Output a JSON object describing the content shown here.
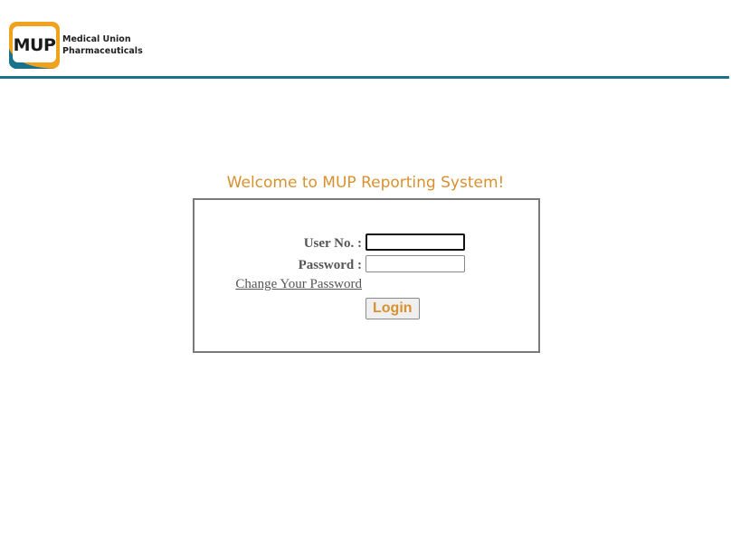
{
  "header": {
    "logo_text": "MUP",
    "company_line1": "Medical Union",
    "company_line2": "Pharmaceuticals"
  },
  "welcome_text": "Welcome to MUP Reporting System!",
  "form": {
    "user_label": "User No. :",
    "user_value": "",
    "password_label": "Password :",
    "password_value": "",
    "change_password_link": "Change Your Password",
    "login_button": "Login"
  },
  "colors": {
    "accent": "#d8912f",
    "header_rule": "#17728a",
    "logo_orange": "#f0a21f",
    "logo_teal": "#17728a"
  }
}
